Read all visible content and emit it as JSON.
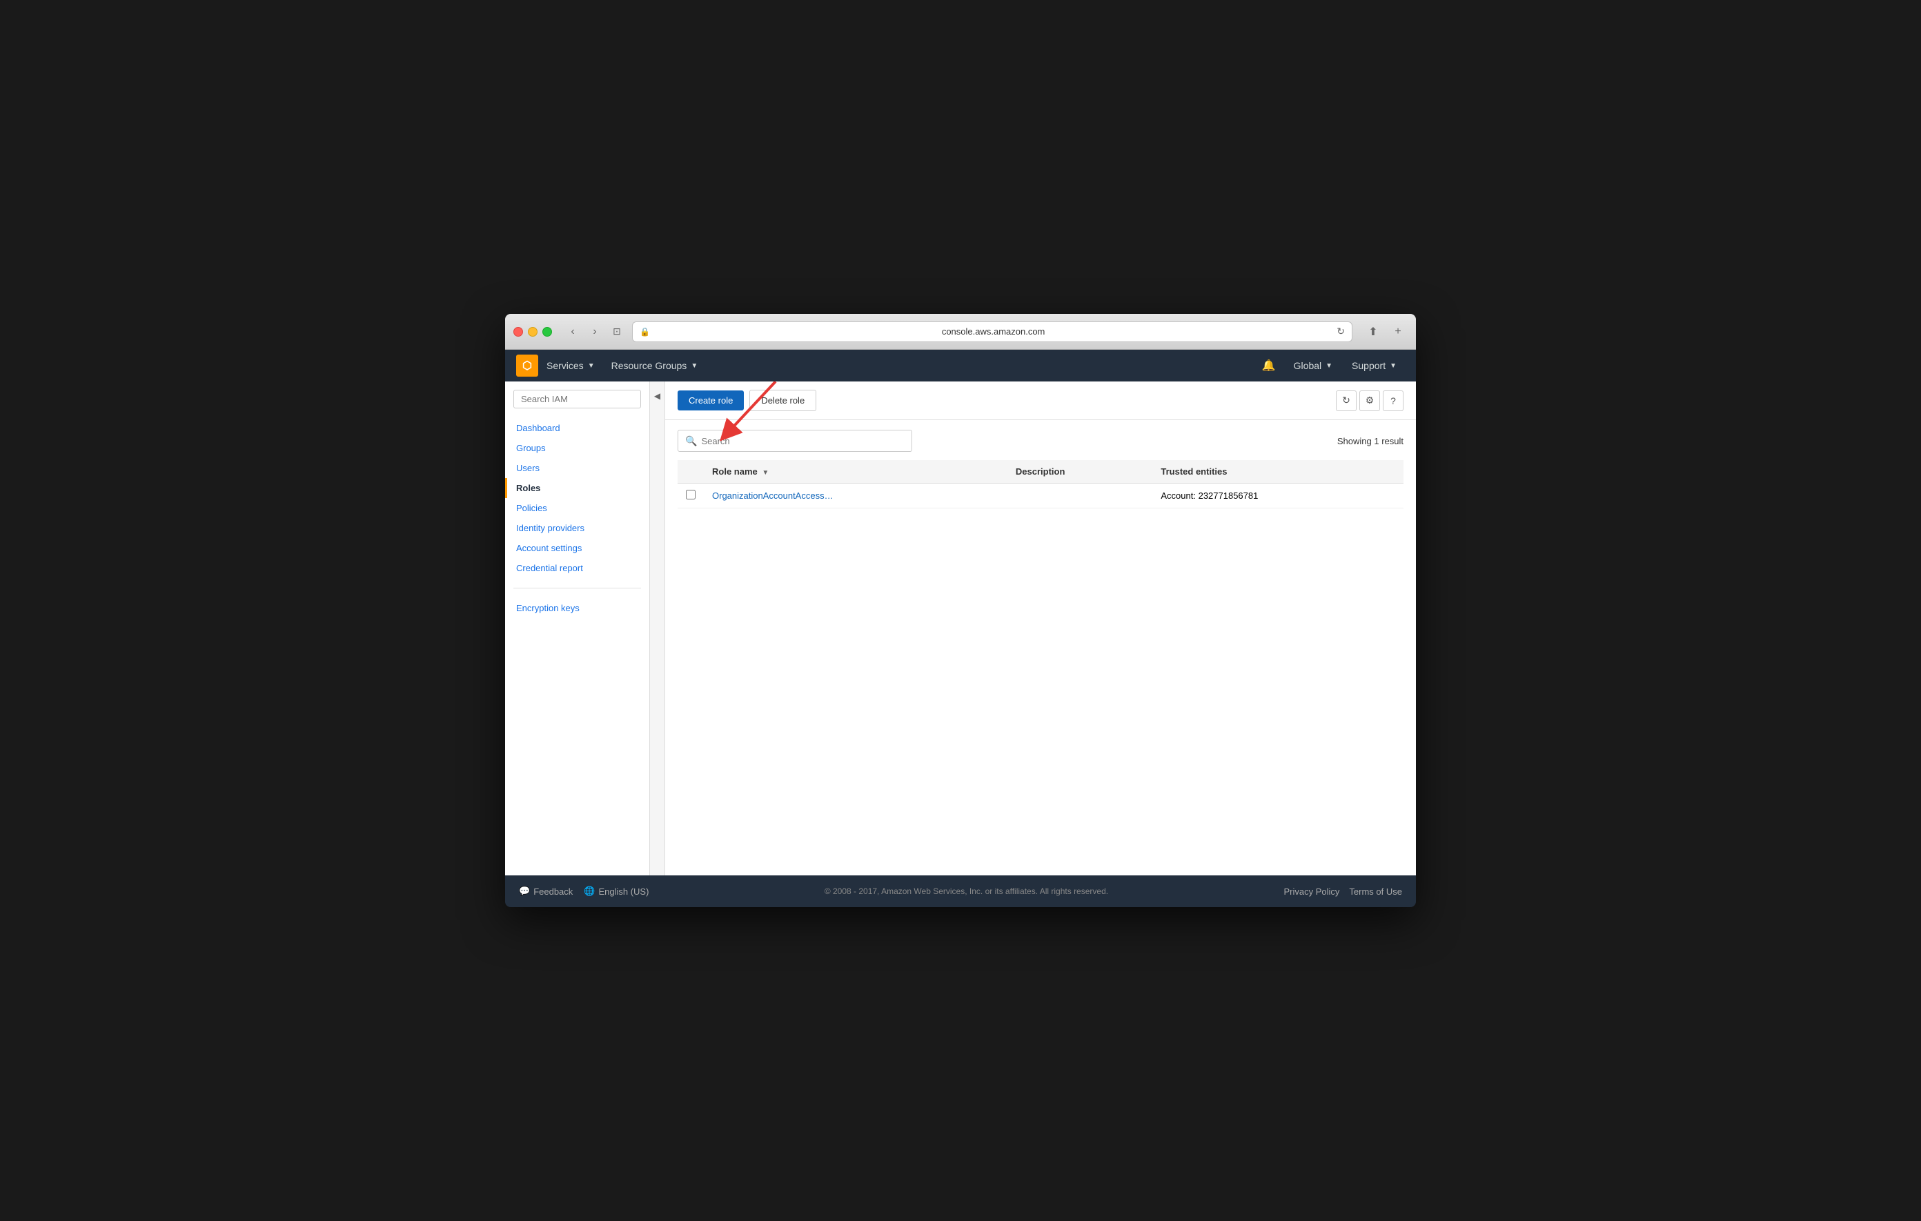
{
  "browser": {
    "url": "console.aws.amazon.com",
    "traffic_lights": [
      "red",
      "yellow",
      "green"
    ]
  },
  "topnav": {
    "logo_icon": "🟧",
    "services_label": "Services",
    "resource_groups_label": "Resource Groups",
    "notification_icon": "🔔",
    "global_label": "Global",
    "support_label": "Support"
  },
  "sidebar": {
    "search_placeholder": "Search IAM",
    "nav_items": [
      {
        "label": "Dashboard",
        "active": false,
        "id": "dashboard"
      },
      {
        "label": "Groups",
        "active": false,
        "id": "groups"
      },
      {
        "label": "Users",
        "active": false,
        "id": "users"
      },
      {
        "label": "Roles",
        "active": true,
        "id": "roles"
      },
      {
        "label": "Policies",
        "active": false,
        "id": "policies"
      },
      {
        "label": "Identity providers",
        "active": false,
        "id": "identity-providers"
      },
      {
        "label": "Account settings",
        "active": false,
        "id": "account-settings"
      },
      {
        "label": "Credential report",
        "active": false,
        "id": "credential-report"
      }
    ],
    "extra_items": [
      {
        "label": "Encryption keys",
        "id": "encryption-keys"
      }
    ]
  },
  "toolbar": {
    "create_role_label": "Create role",
    "delete_role_label": "Delete role",
    "refresh_icon": "↻",
    "settings_icon": "⚙",
    "help_icon": "?"
  },
  "table": {
    "search_placeholder": "Search",
    "result_text": "Showing 1 result",
    "columns": [
      "Role name",
      "Description",
      "Trusted entities"
    ],
    "rows": [
      {
        "role_name": "OrganizationAccountAccess…",
        "description": "",
        "trusted_entities": "Account: 232771856781"
      }
    ]
  },
  "footer": {
    "feedback_label": "Feedback",
    "feedback_icon": "💬",
    "language_icon": "🌐",
    "language_label": "English (US)",
    "copyright": "© 2008 - 2017, Amazon Web Services, Inc. or its affiliates. All rights reserved.",
    "privacy_policy_label": "Privacy Policy",
    "terms_of_use_label": "Terms of Use"
  }
}
